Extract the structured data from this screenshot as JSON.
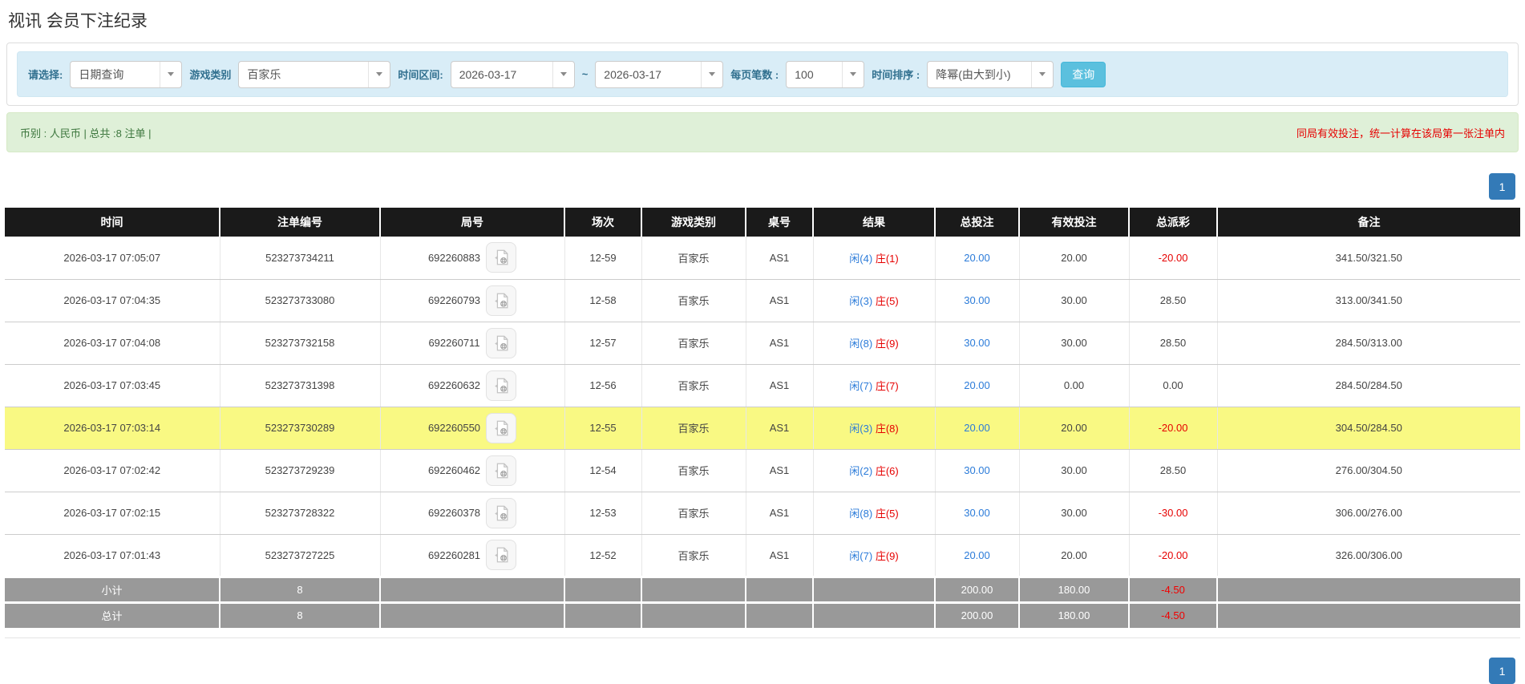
{
  "page": {
    "title": "视讯 会员下注纪录"
  },
  "filters": {
    "select_label": "请选择:",
    "select_value": "日期查询",
    "game_type_label": "游戏类别",
    "game_type_value": "百家乐",
    "time_range_label": "时间区间:",
    "date_from": "2026-03-17",
    "range_separator": "~",
    "date_to": "2026-03-17",
    "page_size_label": "每页笔数 :",
    "page_size_value": "100",
    "time_sort_label": "时间排序 :",
    "time_sort_value": "降幂(由大到小)",
    "search_button": "查询"
  },
  "summary_bar": {
    "left_text": "币别 : 人民币 | 总共 :8 注单 |",
    "right_text": "同局有效投注，统一计算在该局第一张注单内"
  },
  "pagination": {
    "page": "1"
  },
  "icons": {
    "round_replay": "video-file-icon",
    "dropdown": "chevron-down-icon"
  },
  "colors": {
    "filter_bg": "#d9edf7",
    "filter_label": "#31708f",
    "query_button": "#5bc0de",
    "summary_bg": "#dff0d8",
    "summary_text": "#3c763d",
    "warning_red": "#e60000",
    "header_bg": "#1a1a1a",
    "link_blue": "#2b7bd9",
    "highlight_row": "#f9f983",
    "footer_gray": "#999999",
    "pager_blue": "#337ab7"
  },
  "table": {
    "headers": [
      "时间",
      "注单编号",
      "局号",
      "场次",
      "游戏类别",
      "桌号",
      "结果",
      "总投注",
      "有效投注",
      "总派彩",
      "备注"
    ],
    "rows": [
      {
        "time": "2026-03-17 07:05:07",
        "bet_id": "523273734211",
        "round_id": "692260883",
        "session": "12-59",
        "game": "百家乐",
        "table_no": "AS1",
        "result_player": "闲(4)",
        "result_banker": "庄(1)",
        "total_bet": "20.00",
        "valid_bet": "20.00",
        "payout": "-20.00",
        "remark": "341.50/321.50",
        "highlighted": false
      },
      {
        "time": "2026-03-17 07:04:35",
        "bet_id": "523273733080",
        "round_id": "692260793",
        "session": "12-58",
        "game": "百家乐",
        "table_no": "AS1",
        "result_player": "闲(3)",
        "result_banker": "庄(5)",
        "total_bet": "30.00",
        "valid_bet": "30.00",
        "payout": "28.50",
        "remark": "313.00/341.50",
        "highlighted": false
      },
      {
        "time": "2026-03-17 07:04:08",
        "bet_id": "523273732158",
        "round_id": "692260711",
        "session": "12-57",
        "game": "百家乐",
        "table_no": "AS1",
        "result_player": "闲(8)",
        "result_banker": "庄(9)",
        "total_bet": "30.00",
        "valid_bet": "30.00",
        "payout": "28.50",
        "remark": "284.50/313.00",
        "highlighted": false
      },
      {
        "time": "2026-03-17 07:03:45",
        "bet_id": "523273731398",
        "round_id": "692260632",
        "session": "12-56",
        "game": "百家乐",
        "table_no": "AS1",
        "result_player": "闲(7)",
        "result_banker": "庄(7)",
        "total_bet": "20.00",
        "valid_bet": "0.00",
        "payout": "0.00",
        "remark": "284.50/284.50",
        "highlighted": false
      },
      {
        "time": "2026-03-17 07:03:14",
        "bet_id": "523273730289",
        "round_id": "692260550",
        "session": "12-55",
        "game": "百家乐",
        "table_no": "AS1",
        "result_player": "闲(3)",
        "result_banker": "庄(8)",
        "total_bet": "20.00",
        "valid_bet": "20.00",
        "payout": "-20.00",
        "remark": "304.50/284.50",
        "highlighted": true
      },
      {
        "time": "2026-03-17 07:02:42",
        "bet_id": "523273729239",
        "round_id": "692260462",
        "session": "12-54",
        "game": "百家乐",
        "table_no": "AS1",
        "result_player": "闲(2)",
        "result_banker": "庄(6)",
        "total_bet": "30.00",
        "valid_bet": "30.00",
        "payout": "28.50",
        "remark": "276.00/304.50",
        "highlighted": false
      },
      {
        "time": "2026-03-17 07:02:15",
        "bet_id": "523273728322",
        "round_id": "692260378",
        "session": "12-53",
        "game": "百家乐",
        "table_no": "AS1",
        "result_player": "闲(8)",
        "result_banker": "庄(5)",
        "total_bet": "30.00",
        "valid_bet": "30.00",
        "payout": "-30.00",
        "remark": "306.00/276.00",
        "highlighted": false
      },
      {
        "time": "2026-03-17 07:01:43",
        "bet_id": "523273727225",
        "round_id": "692260281",
        "session": "12-52",
        "game": "百家乐",
        "table_no": "AS1",
        "result_player": "闲(7)",
        "result_banker": "庄(9)",
        "total_bet": "20.00",
        "valid_bet": "20.00",
        "payout": "-20.00",
        "remark": "326.00/306.00",
        "highlighted": false
      }
    ],
    "subtotal": {
      "label": "小计",
      "count": "8",
      "total_bet": "200.00",
      "valid_bet": "180.00",
      "payout": "-4.50",
      "remark": ""
    },
    "total": {
      "label": "总计",
      "count": "8",
      "total_bet": "200.00",
      "valid_bet": "180.00",
      "payout": "-4.50",
      "remark": ""
    }
  }
}
